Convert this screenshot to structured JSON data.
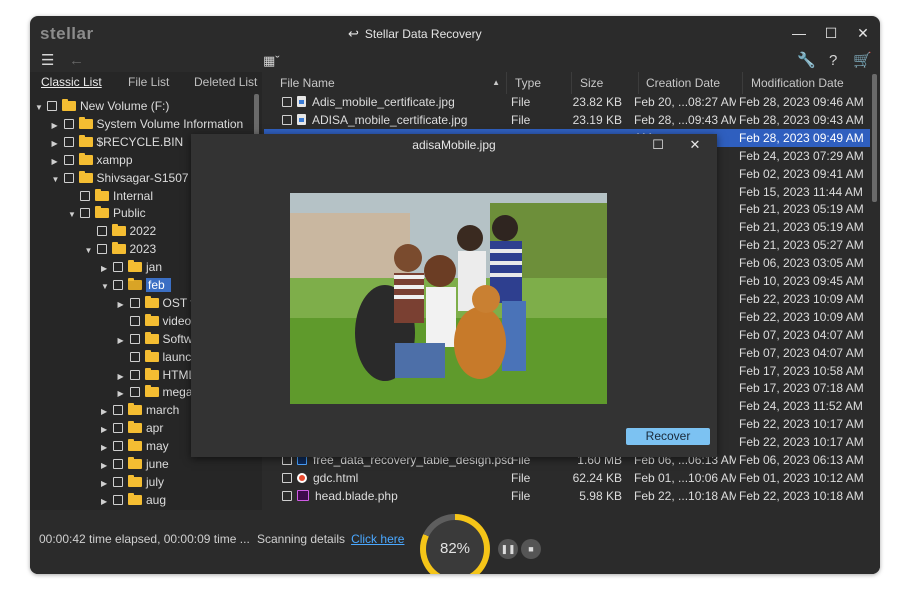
{
  "app": {
    "logo": "stellar",
    "title": "Stellar Data Recovery"
  },
  "tabs": [
    "Classic List",
    "File List",
    "Deleted List"
  ],
  "tree": [
    {
      "label": "New Volume (F:)",
      "depth": 0,
      "arrow": "down",
      "icon": "drive"
    },
    {
      "label": "System Volume Information",
      "depth": 1,
      "arrow": "right",
      "icon": "folder"
    },
    {
      "label": "$RECYCLE.BIN",
      "depth": 1,
      "arrow": "right",
      "icon": "folder"
    },
    {
      "label": "xampp",
      "depth": 1,
      "arrow": "right",
      "icon": "folder"
    },
    {
      "label": "Shivsagar-S1507",
      "depth": 1,
      "arrow": "down",
      "icon": "folder"
    },
    {
      "label": "Internal",
      "depth": 2,
      "arrow": "",
      "icon": "folder"
    },
    {
      "label": "Public",
      "depth": 2,
      "arrow": "down",
      "icon": "folder"
    },
    {
      "label": "2022",
      "depth": 3,
      "arrow": "",
      "icon": "folder"
    },
    {
      "label": "2023",
      "depth": 3,
      "arrow": "down",
      "icon": "folder"
    },
    {
      "label": "jan",
      "depth": 4,
      "arrow": "right",
      "icon": "folder"
    },
    {
      "label": "feb",
      "depth": 4,
      "arrow": "down",
      "icon": "folder-open",
      "selected": true
    },
    {
      "label": "OST t",
      "depth": 5,
      "arrow": "right",
      "icon": "folder"
    },
    {
      "label": "video",
      "depth": 5,
      "arrow": "",
      "icon": "folder"
    },
    {
      "label": "Softw",
      "depth": 5,
      "arrow": "right",
      "icon": "folder"
    },
    {
      "label": "launc",
      "depth": 5,
      "arrow": "",
      "icon": "folder"
    },
    {
      "label": "HTML",
      "depth": 5,
      "arrow": "right",
      "icon": "folder"
    },
    {
      "label": "mega",
      "depth": 5,
      "arrow": "right",
      "icon": "folder"
    },
    {
      "label": "march",
      "depth": 4,
      "arrow": "right",
      "icon": "folder"
    },
    {
      "label": "apr",
      "depth": 4,
      "arrow": "right",
      "icon": "folder"
    },
    {
      "label": "may",
      "depth": 4,
      "arrow": "right",
      "icon": "folder"
    },
    {
      "label": "june",
      "depth": 4,
      "arrow": "right",
      "icon": "folder"
    },
    {
      "label": "july",
      "depth": 4,
      "arrow": "right",
      "icon": "folder"
    },
    {
      "label": "aug",
      "depth": 4,
      "arrow": "right",
      "icon": "folder"
    }
  ],
  "columns": [
    "File Name",
    "Type",
    "Size",
    "Creation Date",
    "Modification Date"
  ],
  "files": [
    {
      "name": "Adis_mobile_certificate.jpg",
      "type": "File",
      "size": "23.82 KB",
      "created": "Feb 20, ...08:27 AM",
      "modified": "Feb 28, 2023 09:46 AM",
      "icon": "jpg"
    },
    {
      "name": "ADISA_mobile_certificate.jpg",
      "type": "File",
      "size": "23.19 KB",
      "created": "Feb 28, ...09:43 AM",
      "modified": "Feb 28, 2023 09:43 AM",
      "icon": "jpg"
    },
    {
      "name": "",
      "type": "",
      "size": "",
      "created": "AM",
      "modified": "Feb 28, 2023 09:49 AM",
      "icon": "",
      "selected": true
    },
    {
      "name": "",
      "type": "",
      "size": "",
      "created": "AM",
      "modified": "Feb 24, 2023 07:29 AM",
      "icon": ""
    },
    {
      "name": "",
      "type": "",
      "size": "",
      "created": "AM",
      "modified": "Feb 02, 2023 09:41 AM",
      "icon": ""
    },
    {
      "name": "",
      "type": "",
      "size": "",
      "created": "AM",
      "modified": "Feb 15, 2023 11:44 AM",
      "icon": ""
    },
    {
      "name": "",
      "type": "",
      "size": "",
      "created": "AM",
      "modified": "Feb 21, 2023 05:19 AM",
      "icon": ""
    },
    {
      "name": "",
      "type": "",
      "size": "",
      "created": "AM",
      "modified": "Feb 21, 2023 05:19 AM",
      "icon": ""
    },
    {
      "name": "",
      "type": "",
      "size": "",
      "created": "AM",
      "modified": "Feb 21, 2023 05:27 AM",
      "icon": ""
    },
    {
      "name": "",
      "type": "",
      "size": "",
      "created": "AM",
      "modified": "Feb 06, 2023 03:05 AM",
      "icon": ""
    },
    {
      "name": "",
      "type": "",
      "size": "",
      "created": "AM",
      "modified": "Feb 10, 2023 09:45 AM",
      "icon": ""
    },
    {
      "name": "",
      "type": "",
      "size": "",
      "created": "AM",
      "modified": "Feb 22, 2023 10:09 AM",
      "icon": ""
    },
    {
      "name": "",
      "type": "",
      "size": "",
      "created": "AM",
      "modified": "Feb 22, 2023 10:09 AM",
      "icon": ""
    },
    {
      "name": "",
      "type": "",
      "size": "",
      "created": "AM",
      "modified": "Feb 07, 2023 04:07 AM",
      "icon": ""
    },
    {
      "name": "",
      "type": "",
      "size": "",
      "created": "AM",
      "modified": "Feb 07, 2023 04:07 AM",
      "icon": ""
    },
    {
      "name": "",
      "type": "",
      "size": "",
      "created": "AM",
      "modified": "Feb 17, 2023 10:58 AM",
      "icon": ""
    },
    {
      "name": "",
      "type": "",
      "size": "",
      "created": "AM",
      "modified": "Feb 17, 2023 07:18 AM",
      "icon": ""
    },
    {
      "name": "",
      "type": "",
      "size": "",
      "created": "AM",
      "modified": "Feb 24, 2023 11:52 AM",
      "icon": ""
    },
    {
      "name": "",
      "type": "",
      "size": "",
      "created": "AM",
      "modified": "Feb 22, 2023 10:17 AM",
      "icon": ""
    },
    {
      "name": "",
      "type": "",
      "size": "",
      "created": "AM",
      "modified": "Feb 22, 2023 10:17 AM",
      "icon": ""
    },
    {
      "name": "free_data_recovery_table_design.psd",
      "type": "File",
      "size": "1.60 MB",
      "created": "Feb 06, ...06:13 AM",
      "modified": "Feb 06, 2023 06:13 AM",
      "icon": "psd"
    },
    {
      "name": "gdc.html",
      "type": "File",
      "size": "62.24 KB",
      "created": "Feb 01, ...10:06 AM",
      "modified": "Feb 01, 2023 10:12 AM",
      "icon": "html"
    },
    {
      "name": "head.blade.php",
      "type": "File",
      "size": "5.98 KB",
      "created": "Feb 22, ...10:18 AM",
      "modified": "Feb 22, 2023 10:18 AM",
      "icon": "dw"
    }
  ],
  "status": {
    "elapsed": "00:00:42 time elapsed, 00:00:09 time ...",
    "scanning_details": "Scanning details",
    "click_here": "Click here",
    "progress_label": "82%",
    "progress": 0.82
  },
  "preview": {
    "title": "adisaMobile.jpg",
    "recover_label": "Recover"
  },
  "colors": {
    "accent": "#2f5fbf",
    "progress": "#f5c518",
    "recover": "#7cc2f2",
    "folder": "#f4bd32"
  }
}
